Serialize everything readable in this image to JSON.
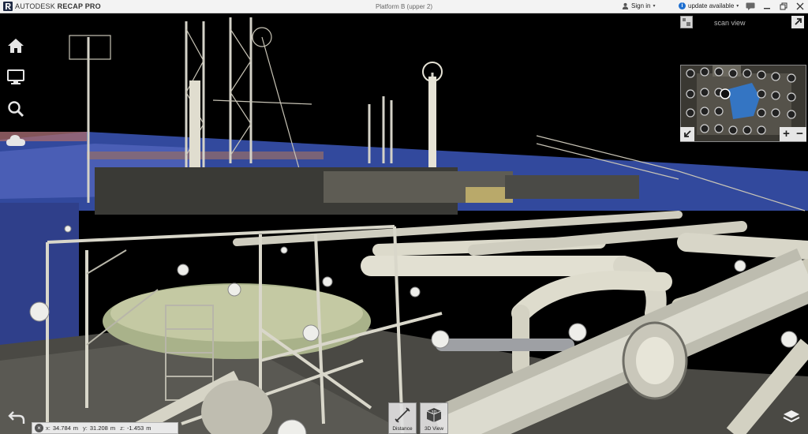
{
  "app": {
    "brand": "AUTODESK",
    "product": "RECAP PRO",
    "document_title": "Platform B (upper 2)"
  },
  "titlebar": {
    "sign_in": "Sign in",
    "update_label": "update available",
    "info_glyph": "i",
    "caret_glyph": "▾",
    "icons": [
      "user-icon",
      "info-icon",
      "chat-icon",
      "minimize-icon",
      "restore-icon",
      "close-icon"
    ]
  },
  "left_nav": {
    "items": [
      "home-icon",
      "display-icon",
      "search-icon",
      "cloud-icon"
    ]
  },
  "minimap": {
    "label": "scan view",
    "zoom_in": "+",
    "zoom_out": "−"
  },
  "coords": {
    "close_glyph": "×",
    "x_label": "x:",
    "x_value": "34.784",
    "x_unit": "m",
    "y_label": "y:",
    "y_value": "31.208",
    "y_unit": "m",
    "z_label": "z:",
    "z_value": "-1.453",
    "z_unit": "m"
  },
  "toolbar": {
    "distance_label": "Distance",
    "view3d_label": "3D View",
    "view3d_icon_text": "3D"
  },
  "colors": {
    "background": "#000000",
    "titlebar": "#f3f3f3",
    "accent_blue": "#1e6fd0",
    "scan_blue": "#3b56b8",
    "pipe_light": "#d9d6c4"
  }
}
